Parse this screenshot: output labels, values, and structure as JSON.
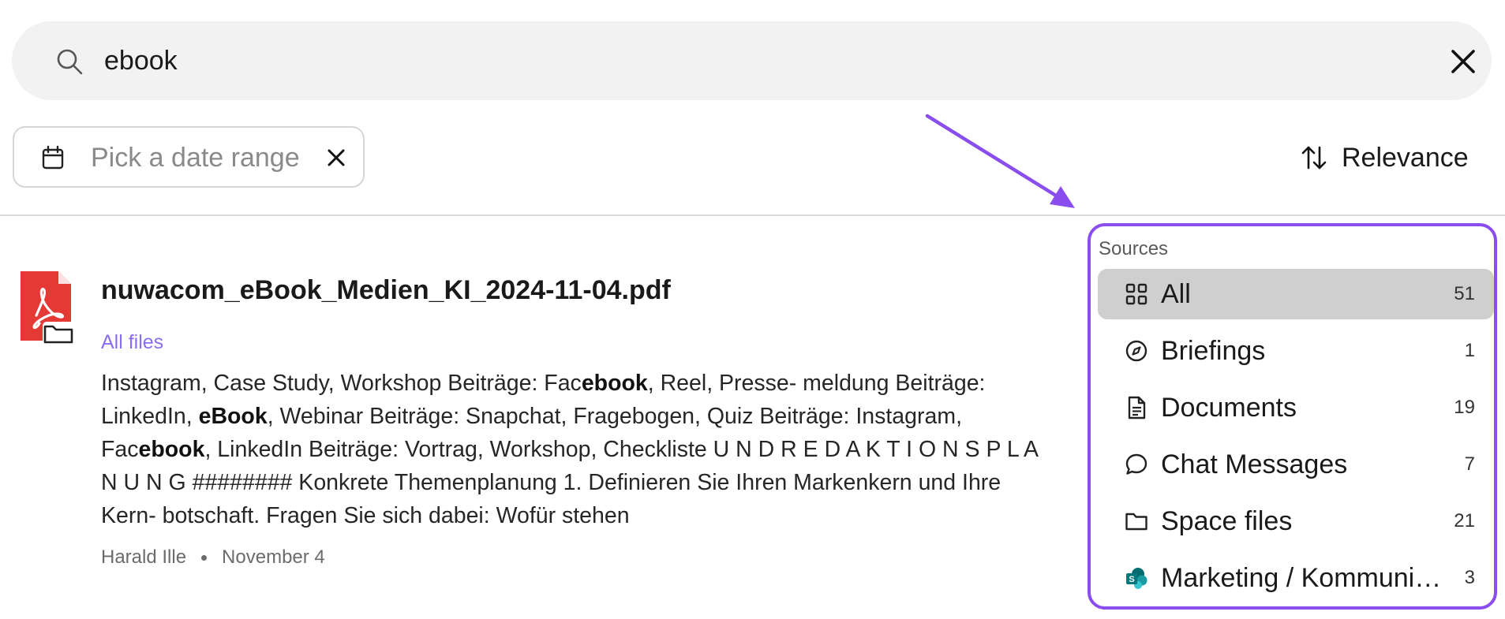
{
  "search": {
    "query": "ebook"
  },
  "filters": {
    "date_placeholder": "Pick a date range"
  },
  "sort": {
    "label": "Relevance"
  },
  "result": {
    "title": "nuwacom_eBook_Medien_KI_2024-11-04.pdf",
    "location": "All files",
    "snippet_segments": [
      {
        "text": "Instagram, Case Study, Workshop Beiträge: Fac",
        "bold": false
      },
      {
        "text": "ebook",
        "bold": true
      },
      {
        "text": ", Reel, Presse- meldung Beiträge: LinkedIn, ",
        "bold": false
      },
      {
        "text": "eBook",
        "bold": true
      },
      {
        "text": ", Webinar Beiträge: Snapchat, Fragebogen, Quiz Beiträge: Instagram, Fac",
        "bold": false
      },
      {
        "text": "ebook",
        "bold": true
      },
      {
        "text": ", LinkedIn Beiträge: Vortrag, Workshop, Checkliste U N D R E D A K T I O N S P L A N U N G ######## Konkrete Themenplanung 1. Definieren Sie Ihren Markenkern und Ihre Kern- botschaft. Fragen Sie sich dabei: Wofür stehen",
        "bold": false
      }
    ],
    "author": "Harald Ille",
    "date": "November 4"
  },
  "sources": {
    "heading": "Sources",
    "items": [
      {
        "label": "All",
        "count": "51",
        "icon": "grid-icon",
        "active": true
      },
      {
        "label": "Briefings",
        "count": "1",
        "icon": "compass-icon",
        "active": false
      },
      {
        "label": "Documents",
        "count": "19",
        "icon": "document-icon",
        "active": false
      },
      {
        "label": "Chat Messages",
        "count": "7",
        "icon": "chat-icon",
        "active": false
      },
      {
        "label": "Space files",
        "count": "21",
        "icon": "folder-icon",
        "active": false
      },
      {
        "label": "Marketing / Kommunikation",
        "count": "3",
        "icon": "sharepoint-icon",
        "active": false
      }
    ]
  },
  "colors": {
    "accent": "#8a4dee",
    "link": "#8a6ef2",
    "pdf_red": "#e53935",
    "search_bg": "#f2f2f2",
    "active_bg": "#cfcfcf"
  }
}
